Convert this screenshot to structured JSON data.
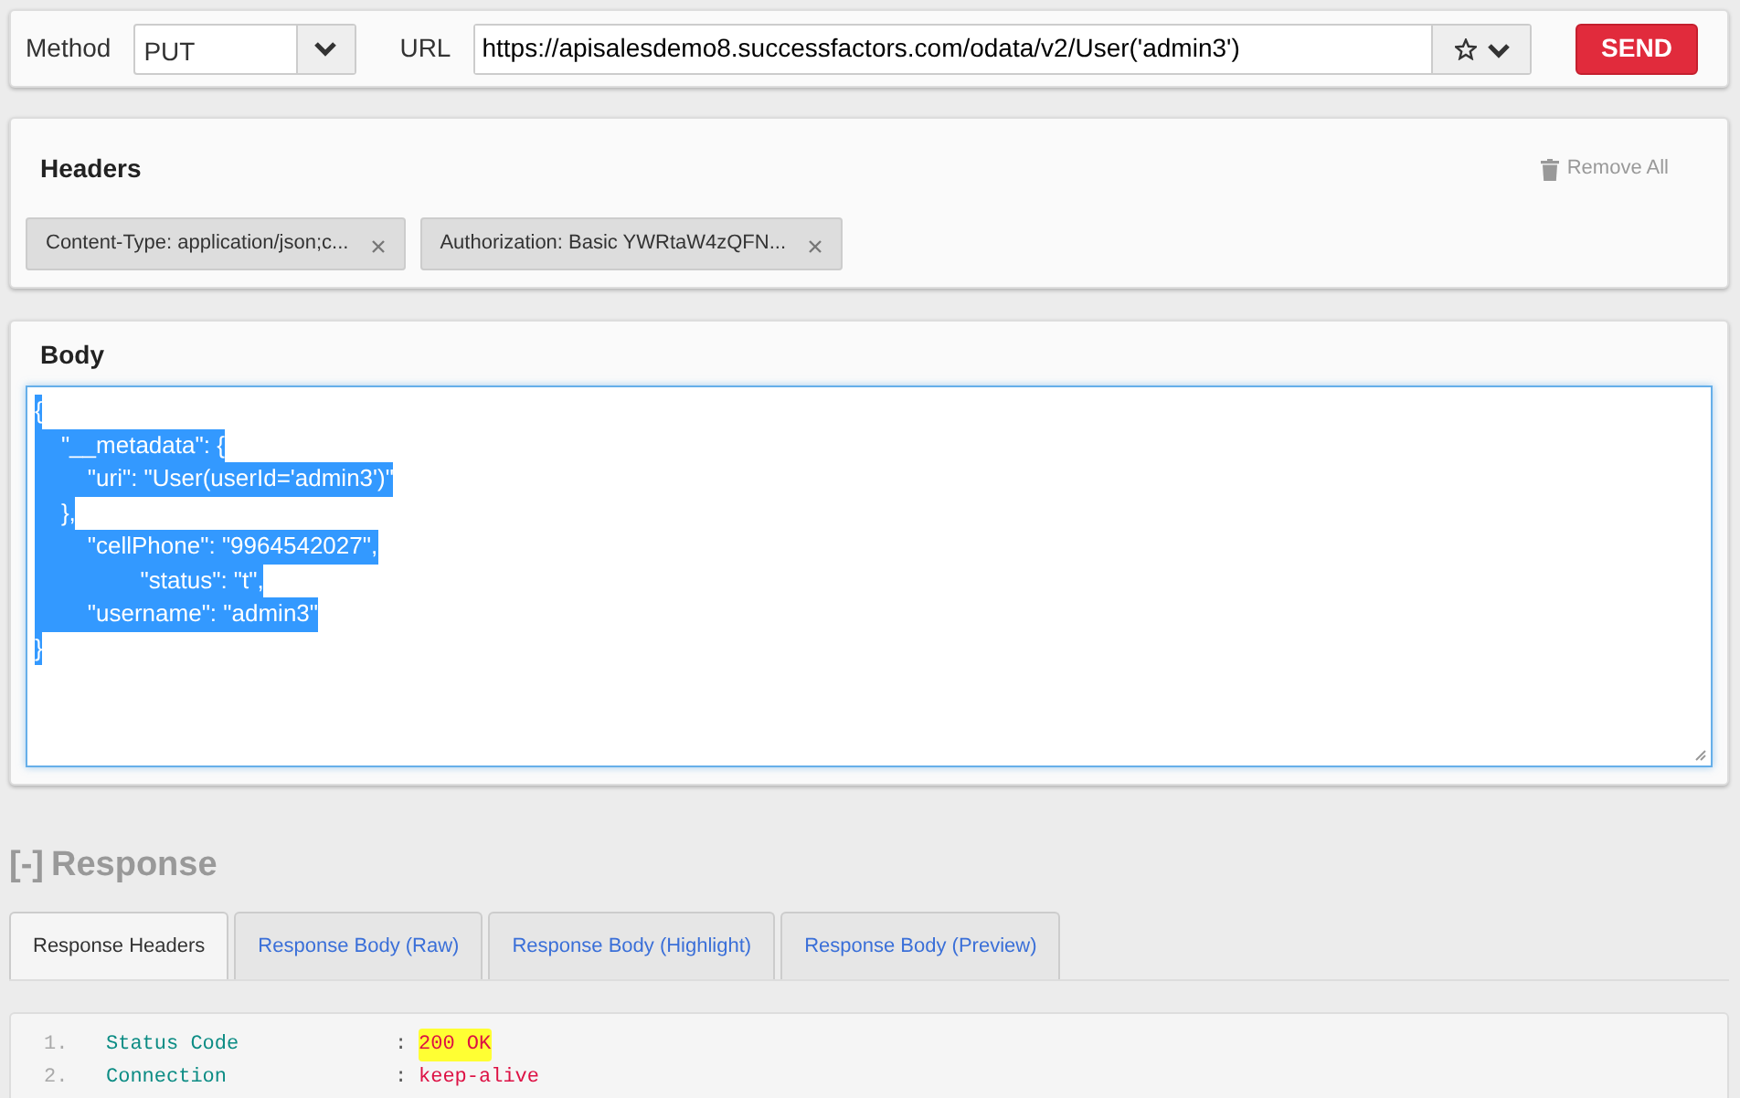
{
  "request": {
    "method_label": "Method",
    "method": "PUT",
    "url_label": "URL",
    "url": "https://apisalesdemo8.successfactors.com/odata/v2/User('admin3')",
    "send": "SEND"
  },
  "headers": {
    "title": "Headers",
    "remove_all": "Remove All",
    "items": [
      {
        "text": "Content-Type: application/json;c..."
      },
      {
        "text": "Authorization: Basic YWRtaW4zQFN..."
      }
    ]
  },
  "body": {
    "title": "Body",
    "selected": true,
    "lines": [
      "{",
      "    \"__metadata\": {",
      "        \"uri\": \"User(userId='admin3')\"",
      "    },",
      "        \"cellPhone\": \"9964542027\",",
      "                \"status\": \"t\",",
      "        \"username\": \"admin3\"",
      "}"
    ]
  },
  "response": {
    "toggle": "[-]",
    "title": "Response",
    "tabs": [
      {
        "label": "Response Headers",
        "selected": true
      },
      {
        "label": "Response Body (Raw)",
        "selected": false
      },
      {
        "label": "Response Body (Highlight)",
        "selected": false
      },
      {
        "label": "Response Body (Preview)",
        "selected": false
      }
    ],
    "rows": [
      {
        "number": "1.",
        "name": "Status Code",
        "separator": ":",
        "value": "200 OK",
        "highlighted": true
      },
      {
        "number": "2.",
        "name": "Connection",
        "separator": ":",
        "value": "keep-alive",
        "highlighted": false
      }
    ]
  }
}
